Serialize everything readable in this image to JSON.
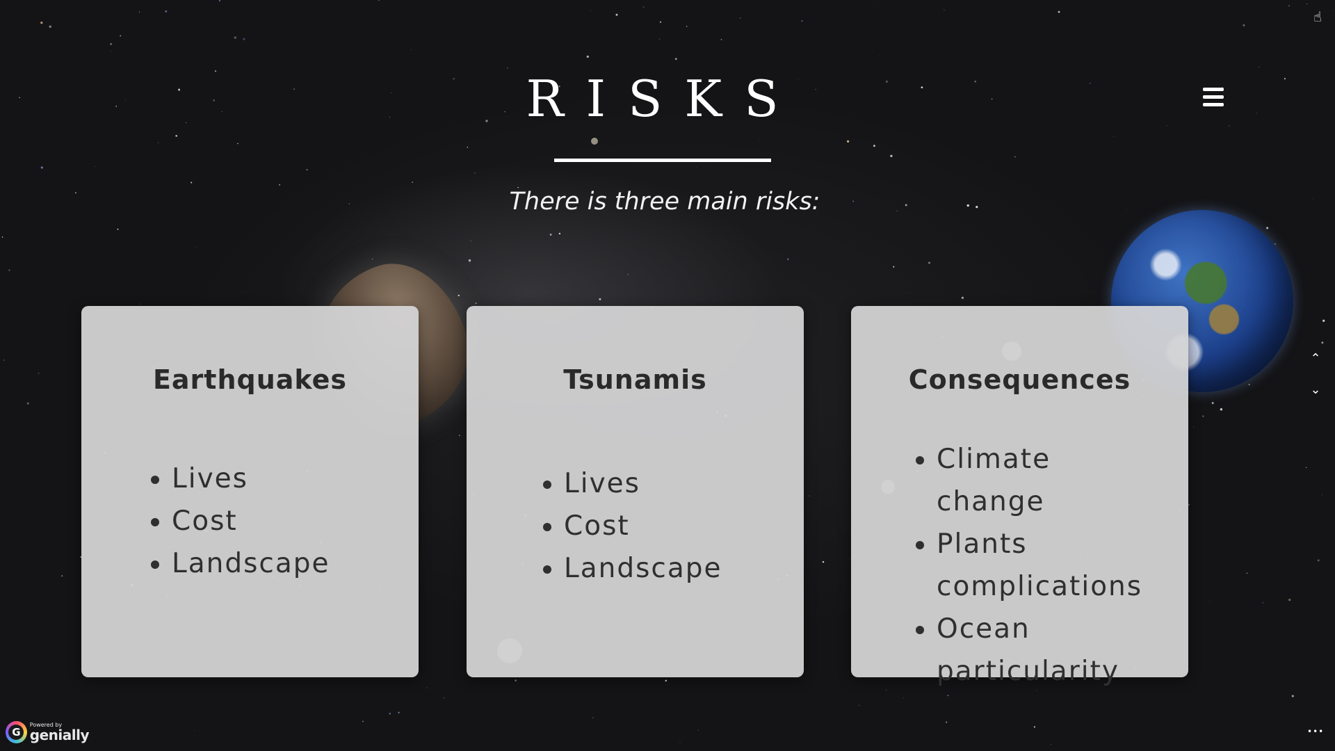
{
  "slide": {
    "title": "RISKS",
    "subtitle": "There is three main risks:"
  },
  "cards": [
    {
      "title": "Earthquakes",
      "items": [
        "Lives",
        "Cost",
        "Landscape"
      ]
    },
    {
      "title": "Tsunamis",
      "items": [
        "Lives",
        "Cost",
        "Landscape"
      ]
    },
    {
      "title": "Consequences",
      "items": [
        "Climate change",
        "Plants complications",
        "Ocean particularity"
      ]
    }
  ],
  "icons": {
    "hand_cursor": "☝",
    "menu": "hamburger-menu-icon",
    "scroll_up": "⌃",
    "scroll_down": "⌄",
    "more": "•••"
  },
  "branding": {
    "powered_by": "Powered by",
    "name": "genially",
    "logo_letter": "G"
  },
  "colors": {
    "background": "#141416",
    "card": "#d4d4d6",
    "text_dark": "#2a2a2a",
    "text_light": "#ffffff"
  }
}
